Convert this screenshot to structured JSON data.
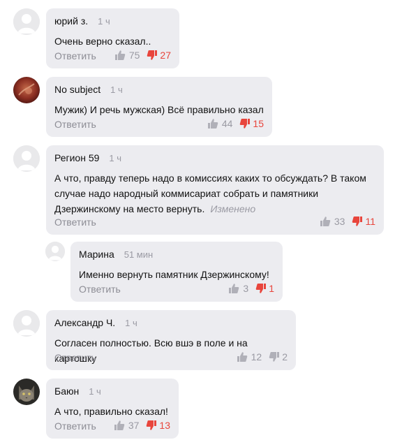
{
  "ui": {
    "reply_label": "Ответить",
    "edited_label": "Изменено"
  },
  "comments": [
    {
      "author": "юрий з.",
      "time": "1 ч",
      "text": "Очень верно сказал..",
      "likes": "75",
      "dislikes": "27",
      "avatar_icon": "user-placeholder-icon"
    },
    {
      "author": "No subject",
      "time": "1 ч",
      "text": "Мужик) И речь мужская) Всё правильно казал",
      "likes": "44",
      "dislikes": "15",
      "avatar_icon": "user-photo"
    },
    {
      "author": "Регион 59",
      "time": "1 ч",
      "text": "А что, правду теперь надо в комиссиях каких то обсуждать? В таком случае надо народный коммисариат собрать и памятники Дзержинскому на место вернуть.",
      "likes": "33",
      "dislikes": "11",
      "avatar_icon": "user-placeholder-icon",
      "edited": true
    },
    {
      "author": "Марина",
      "time": "51 мин",
      "text": "Именно вернуть памятник Дзержинскому!",
      "likes": "3",
      "dislikes": "1",
      "avatar_icon": "user-placeholder-icon"
    },
    {
      "author": "Александр Ч.",
      "time": "1 ч",
      "text": "Согласен полностью. Всю вшэ в поле и на картошку",
      "likes": "12",
      "dislikes": "2",
      "avatar_icon": "user-placeholder-icon"
    },
    {
      "author": "Баюн",
      "time": "1 ч",
      "text": "А что, правильно сказал!",
      "likes": "37",
      "dislikes": "13",
      "avatar_icon": "cat-photo"
    }
  ],
  "colors": {
    "bubble": "#ececf0",
    "dislike_active": "#e8453c",
    "muted": "#9a9aa3"
  }
}
